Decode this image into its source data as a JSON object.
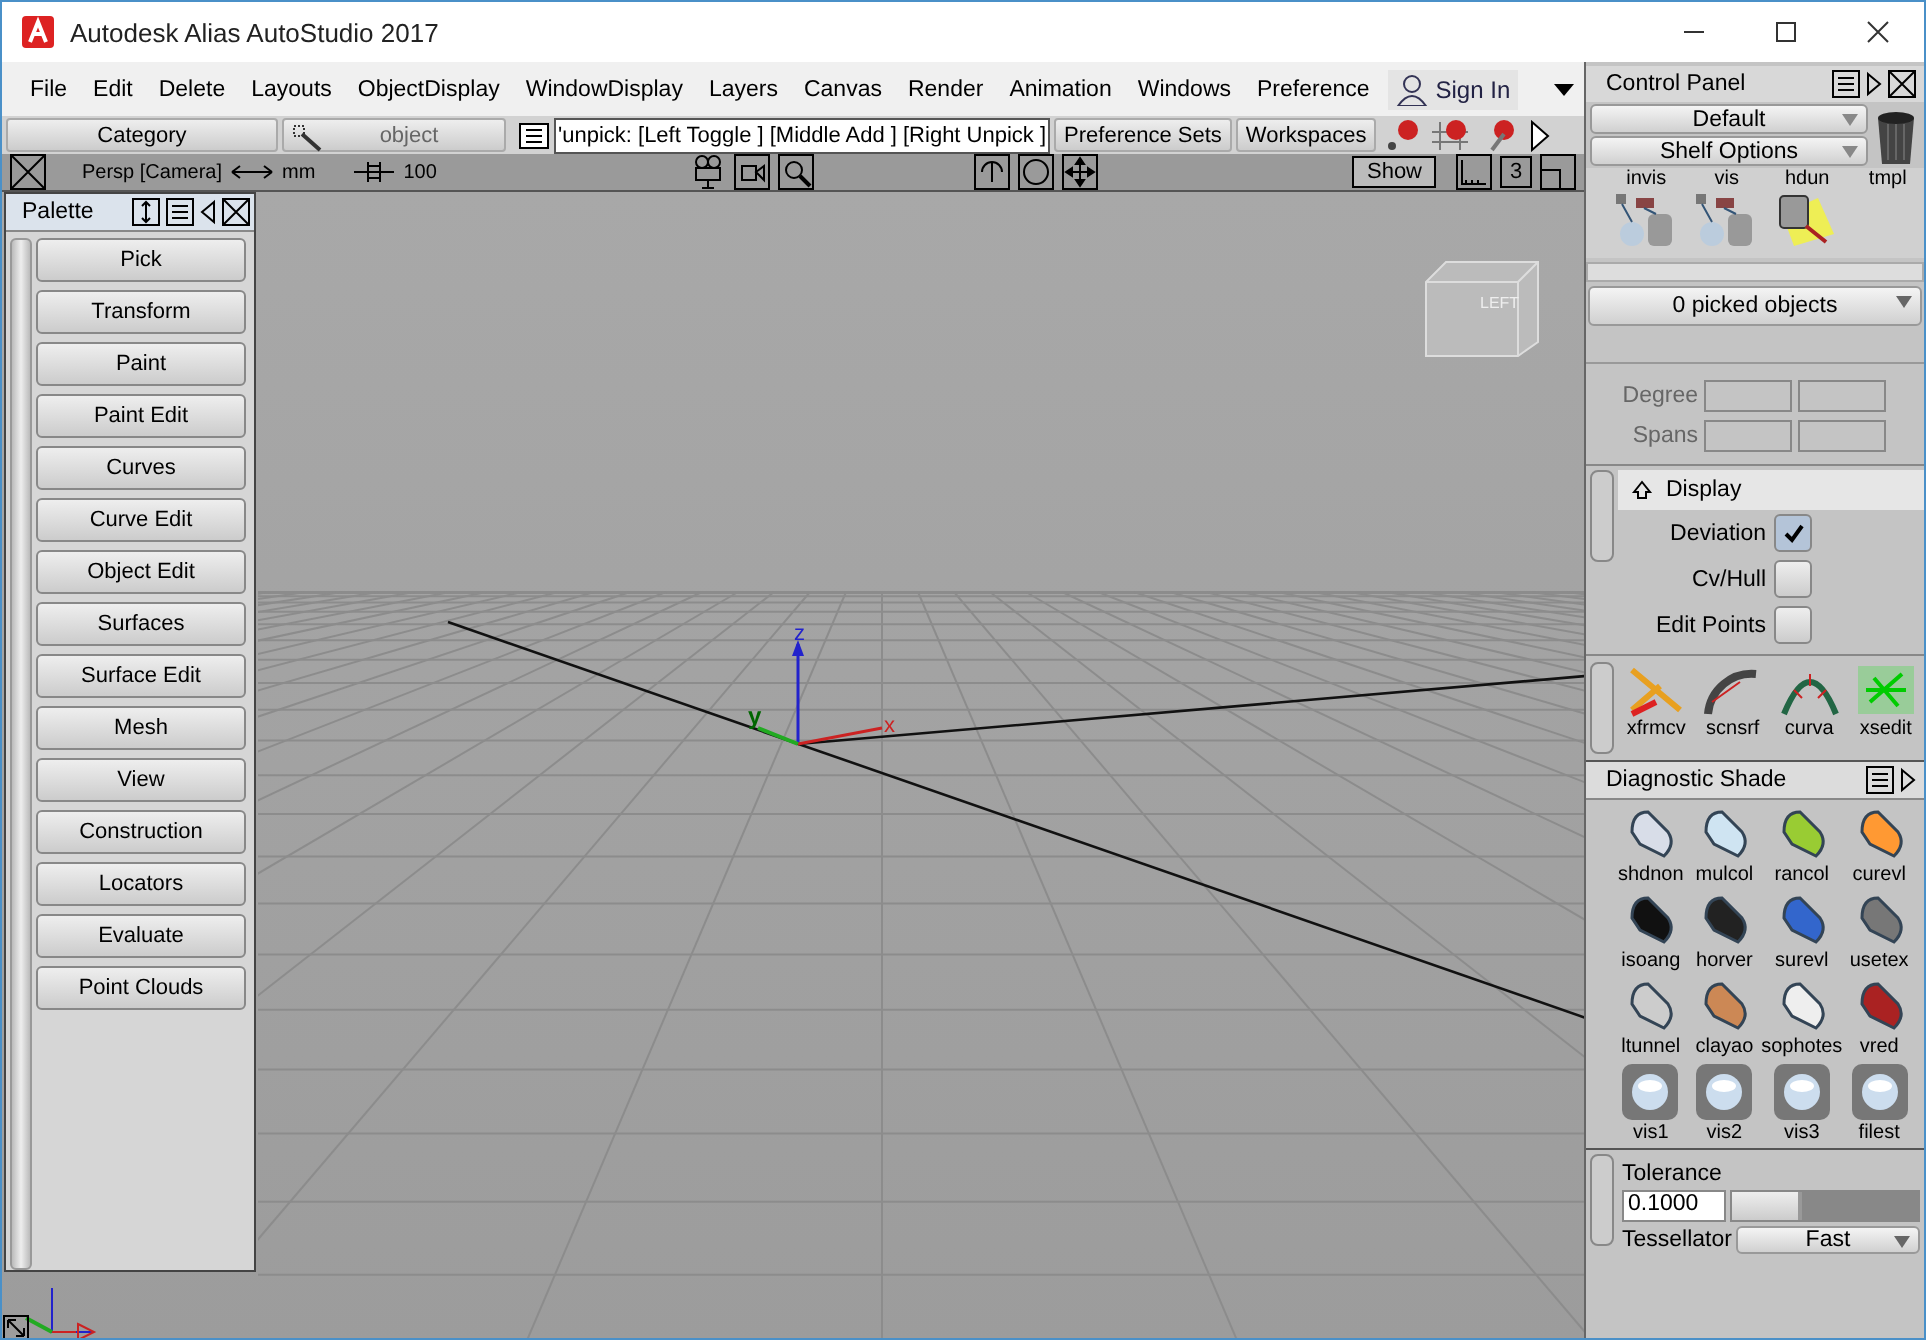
{
  "window": {
    "title": "Autodesk Alias AutoStudio 2017"
  },
  "menu": [
    "File",
    "Edit",
    "Delete",
    "Layouts",
    "ObjectDisplay",
    "WindowDisplay",
    "Layers",
    "Canvas",
    "Render",
    "Animation",
    "Windows",
    "Preference"
  ],
  "sign_in": "Sign In",
  "toolbar": {
    "category": "Category",
    "object": "object",
    "prompt": "'unpick: [Left Toggle ] [Middle Add ] [Right Unpick ]",
    "preference_sets": "Preference Sets",
    "workspaces": "Workspaces"
  },
  "viewport": {
    "camera": "Persp [Camera]",
    "units": "mm",
    "grid": "100",
    "show_button": "Show",
    "count": "3",
    "cube_label": "LEFT",
    "axes": {
      "x": "x",
      "y": "y",
      "z": "z"
    }
  },
  "palette": {
    "title": "Palette",
    "items": [
      {
        "label": "Pick"
      },
      {
        "label": "Transform"
      },
      {
        "label": "Paint"
      },
      {
        "label": "Paint Edit"
      },
      {
        "label": "Curves"
      },
      {
        "label": "Curve Edit"
      },
      {
        "label": "Object Edit"
      },
      {
        "label": "Surfaces"
      },
      {
        "label": "Surface Edit"
      },
      {
        "label": "Mesh"
      },
      {
        "label": "View"
      },
      {
        "label": "Construction"
      },
      {
        "label": "Locators"
      },
      {
        "label": "Evaluate"
      },
      {
        "label": "Point Clouds"
      }
    ]
  },
  "control_panel": {
    "title": "Control Panel",
    "shelf_dropdown": "Default",
    "shelf_options": "Shelf Options",
    "shelf_items": [
      "invis",
      "vis",
      "hdun",
      "tmpl"
    ],
    "picked": "0 picked objects",
    "degree": "Degree",
    "spans": "Spans",
    "display_section": "Display",
    "display_options": [
      {
        "label": "Deviation",
        "checked": true
      },
      {
        "label": "Cv/Hull",
        "checked": false
      },
      {
        "label": "Edit Points",
        "checked": false
      }
    ],
    "tools": [
      "xfrmcv",
      "scnsrf",
      "curva",
      "xsedit"
    ]
  },
  "diagnostic_shade": {
    "title": "Diagnostic Shade",
    "items": [
      "shdnon",
      "mulcol",
      "rancol",
      "curevl",
      "isoang",
      "horver",
      "surevl",
      "usetex",
      "ltunnel",
      "clayao",
      "sophotes",
      "vred",
      "vis1",
      "vis2",
      "vis3",
      "filest"
    ],
    "tolerance_label": "Tolerance",
    "tolerance_value": "0.1000",
    "tolerance_slider": {
      "level": 0.38
    },
    "tessellator_label": "Tessellator",
    "tessellator_value": "Fast"
  }
}
